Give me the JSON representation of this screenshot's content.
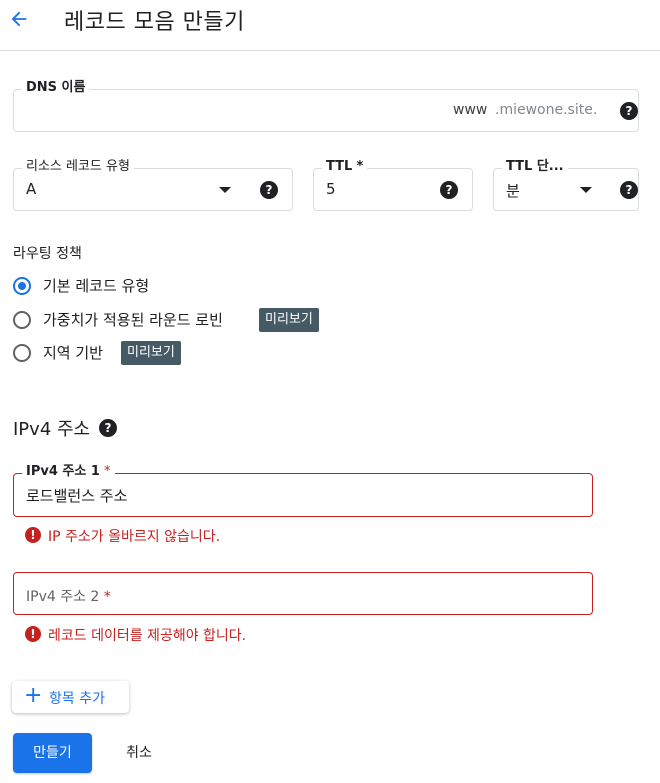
{
  "header": {
    "title": "레코드 모음 만들기"
  },
  "dns": {
    "label": "DNS 이름",
    "prefix": "www",
    "suffix": ".miewone.site.",
    "help": "?"
  },
  "resource_type": {
    "label": "리소스 레코드 유형",
    "value": "A",
    "help": "?"
  },
  "ttl": {
    "label": "TTL",
    "required": "*",
    "value": "5",
    "help": "?"
  },
  "ttl_unit": {
    "label": "TTL 단...",
    "value": "분",
    "help": "?"
  },
  "routing": {
    "label": "라우팅 정책",
    "options": [
      {
        "label": "기본 레코드 유형",
        "selected": true
      },
      {
        "label": "가중치가 적용된 라운드 로빈",
        "badge": "미리보기"
      },
      {
        "label": "지역 기반",
        "badge": "미리보기"
      }
    ]
  },
  "ipv4": {
    "heading": "IPv4 주소",
    "fields": [
      {
        "label": "IPv4 주소 1",
        "required": "*",
        "value": "로드밸런스 주소",
        "error": "IP 주소가 올바르지 않습니다."
      },
      {
        "label": "IPv4 주소 2",
        "required": "*",
        "placeholder": "IPv4 주소 2",
        "error": "레코드 데이터를 제공해야 합니다."
      }
    ]
  },
  "actions": {
    "add_item": "항목 추가",
    "create": "만들기",
    "cancel": "취소"
  },
  "colors": {
    "primary": "#1a73e8",
    "error": "#c5221f",
    "badge": "#455a64"
  }
}
